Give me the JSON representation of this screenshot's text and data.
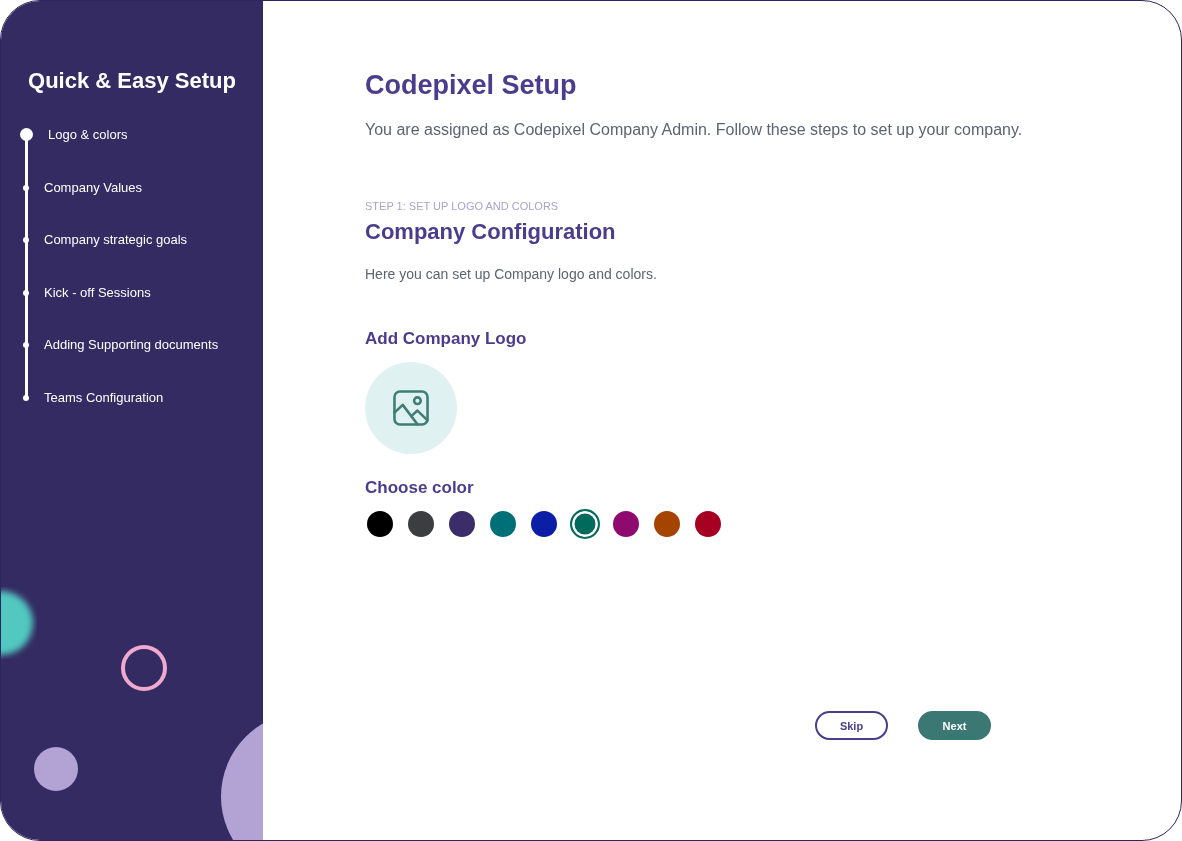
{
  "sidebar": {
    "title": "Quick & Easy Setup",
    "steps": [
      {
        "label": "Logo & colors",
        "selected": true
      },
      {
        "label": "Company Values",
        "selected": false
      },
      {
        "label": "Company strategic goals",
        "selected": false
      },
      {
        "label": "Kick - off Sessions",
        "selected": false
      },
      {
        "label": "Adding Supporting documents",
        "selected": false
      },
      {
        "label": "Teams Configuration",
        "selected": false
      }
    ]
  },
  "main": {
    "title": "Codepixel Setup",
    "intro": "You are assigned as Codepixel Company Admin. Follow these steps to set up your company.",
    "step_label": "STEP 1: SET UP LOGO AND COLORS",
    "section_title": "Company Configuration",
    "section_description": "Here you can set up Company logo and colors.",
    "logo": {
      "label": "Add Company Logo"
    },
    "color_picker": {
      "label": "Choose color",
      "swatches": [
        {
          "color": "#000000",
          "selected": false
        },
        {
          "color": "#3c3d40",
          "selected": false
        },
        {
          "color": "#3a2d6a",
          "selected": false
        },
        {
          "color": "#006f78",
          "selected": false
        },
        {
          "color": "#0a1fa5",
          "selected": false
        },
        {
          "color": "#006b5c",
          "selected": true
        },
        {
          "color": "#8e0a6f",
          "selected": false
        },
        {
          "color": "#a54300",
          "selected": false
        },
        {
          "color": "#a50022",
          "selected": false
        }
      ]
    }
  },
  "buttons": [
    {
      "label": "Skip",
      "kind": "outline"
    },
    {
      "label": "Next",
      "kind": "filled"
    }
  ]
}
